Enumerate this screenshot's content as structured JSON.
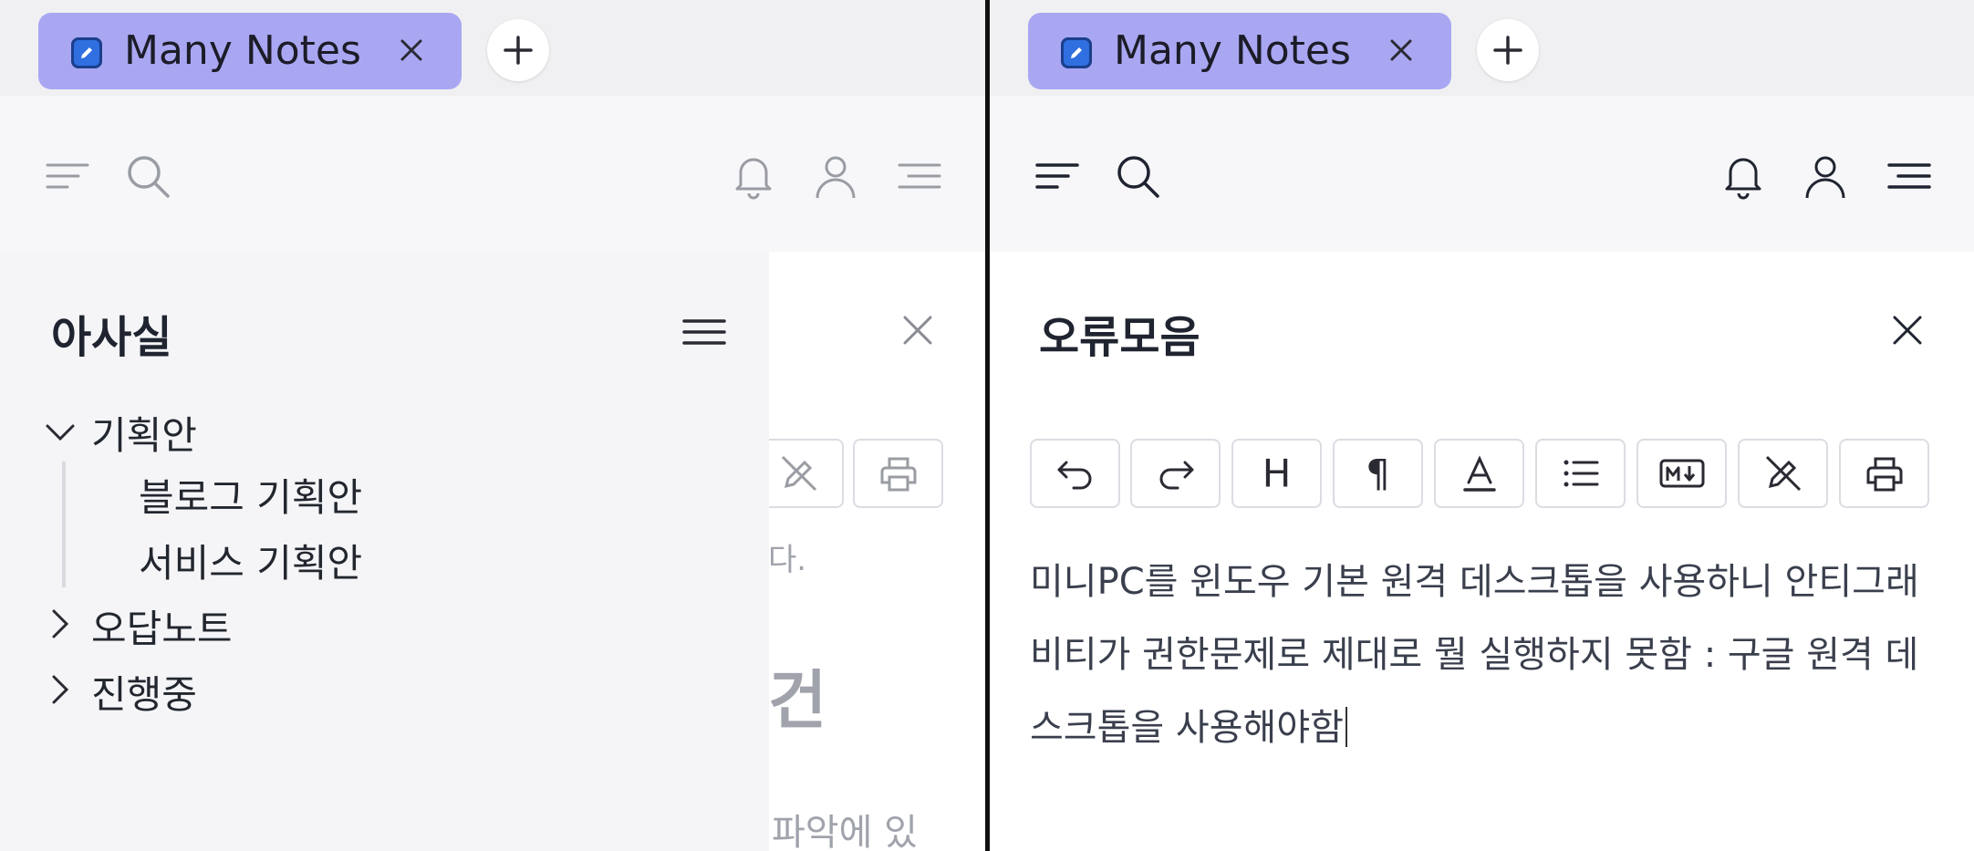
{
  "panes": [
    {
      "tab": {
        "title": "Many Notes"
      },
      "sidebar": {
        "title": "아사실",
        "tree": [
          {
            "label": "기획안",
            "expanded": true,
            "children": [
              "블로그 기획안",
              "서비스 기획안"
            ]
          },
          {
            "label": "오답노트",
            "expanded": false
          },
          {
            "label": "진행중",
            "expanded": false
          }
        ]
      },
      "background_fragments": [
        "다.",
        "건",
        "파악에 있"
      ]
    },
    {
      "tab": {
        "title": "Many Notes"
      },
      "document": {
        "title": "오류모음",
        "content": "미니PC를 윈도우 기본 원격 데스크톱을 사용하니 안티그래비티가 권한문제로 제대로 뭘 실행하지 못함 : 구글 원격 데스크톱을 사용해야함"
      },
      "editor_toolbar": [
        "undo-icon",
        "redo-icon",
        "heading-icon",
        "paragraph-icon",
        "text-color-icon",
        "list-icon",
        "markdown-icon",
        "edit-off-icon",
        "print-icon"
      ],
      "heading_label": "H",
      "paragraph_label": "¶"
    }
  ],
  "colors": {
    "tab": "#a9a7f2",
    "tab_icon": "#2f6fe0",
    "sidebar_bg": "#f5f5f8",
    "toolbar_bg": "#f7f7f9"
  }
}
